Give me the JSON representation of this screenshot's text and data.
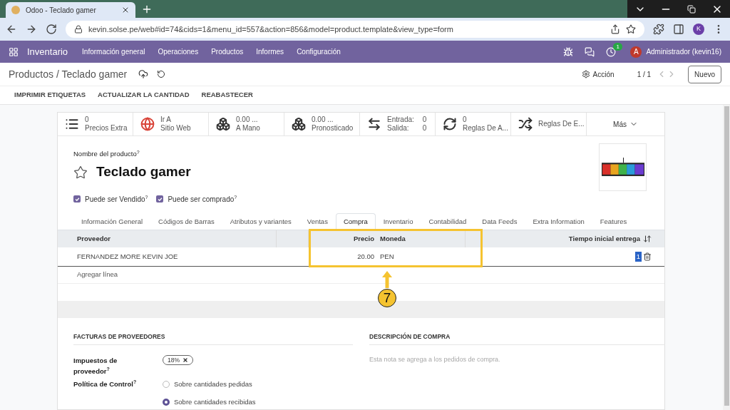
{
  "browser": {
    "tab_title": "Odoo - Teclado gamer",
    "url": "kevin.solse.pe/web#id=74&cids=1&menu_id=557&action=856&model=product.template&view_type=form",
    "profile_letter": "K"
  },
  "navbar": {
    "app": "Inventario",
    "menus": [
      "Información general",
      "Operaciones",
      "Productos",
      "Informes",
      "Configuración"
    ],
    "activity_count": "1",
    "user_initial": "A",
    "user_name": "Administrador (kevin16)"
  },
  "control_panel": {
    "breadcrumb": "Productos / Teclado gamer",
    "action": "Acción",
    "pager": "1 / 1",
    "new_button": "Nuevo"
  },
  "header_buttons": [
    "IMPRIMIR ETIQUETAS",
    "ACTUALIZAR LA CANTIDAD",
    "REABASTECER"
  ],
  "stat_buttons": [
    {
      "kind": "stat",
      "value": "0",
      "label": "Precios Extra"
    },
    {
      "kind": "stat",
      "value": "Ir A",
      "label": "Sitio Web"
    },
    {
      "kind": "stat",
      "value": "0.00 ...",
      "label": "A Mano"
    },
    {
      "kind": "stat",
      "value": "0.00 ...",
      "label": "Pronosticado"
    },
    {
      "kind": "inout",
      "rows": [
        {
          "label": "Entrada:",
          "value": "0"
        },
        {
          "label": "Salida:",
          "value": "0"
        }
      ]
    },
    {
      "kind": "stat",
      "value": "0",
      "label": "Reglas De A..."
    },
    {
      "kind": "single",
      "label": "Reglas De E..."
    },
    {
      "kind": "more",
      "label": "Más"
    }
  ],
  "product": {
    "name_label": "Nombre del producto",
    "name_help": "?",
    "starred": false,
    "name": "Teclado gamer",
    "checkboxes": [
      {
        "label": "Puede ser Vendido",
        "help": "?",
        "checked": true
      },
      {
        "label": "Puede ser comprado",
        "help": "?",
        "checked": true
      }
    ]
  },
  "tabs": [
    {
      "label": "Información General",
      "selected": false
    },
    {
      "label": "Códigos de Barras",
      "selected": false
    },
    {
      "label": "Atributos y variantes",
      "selected": false
    },
    {
      "label": "Ventas",
      "selected": false
    },
    {
      "label": "Compra",
      "selected": true
    },
    {
      "label": "Inventario",
      "selected": false
    },
    {
      "label": "Contabilidad",
      "selected": false
    },
    {
      "label": "Data Feeds",
      "selected": false
    },
    {
      "label": "Extra Information",
      "selected": false
    },
    {
      "label": "Features",
      "selected": false
    }
  ],
  "supplier_table": {
    "columns": [
      "Proveedor",
      "Precio",
      "Moneda",
      "Tiempo inicial entrega"
    ],
    "rows": [
      {
        "proveedor": "FERNANDEZ MORE KEVIN JOE",
        "precio": "20.00",
        "moneda": "PEN",
        "tiempo": "1"
      }
    ],
    "add_line": "Agregar línea"
  },
  "annotation": {
    "number": "7"
  },
  "vendor_bills": {
    "title": "FACTURAS DE PROVEEDORES",
    "taxes_label": "Impuestos de proveedor",
    "taxes_help": "?",
    "tax_tags": [
      "18%"
    ],
    "control_label": "Política de Control",
    "control_help": "?",
    "control_options": [
      {
        "label": "Sobre cantidades pedidas",
        "selected": false
      },
      {
        "label": "Sobre cantidades recibidas",
        "selected": true
      }
    ]
  },
  "purchase_description": {
    "title": "DESCRIPCIÓN DE COMPRA",
    "placeholder": "Esta nota se agrega a los pedidos de compra."
  }
}
